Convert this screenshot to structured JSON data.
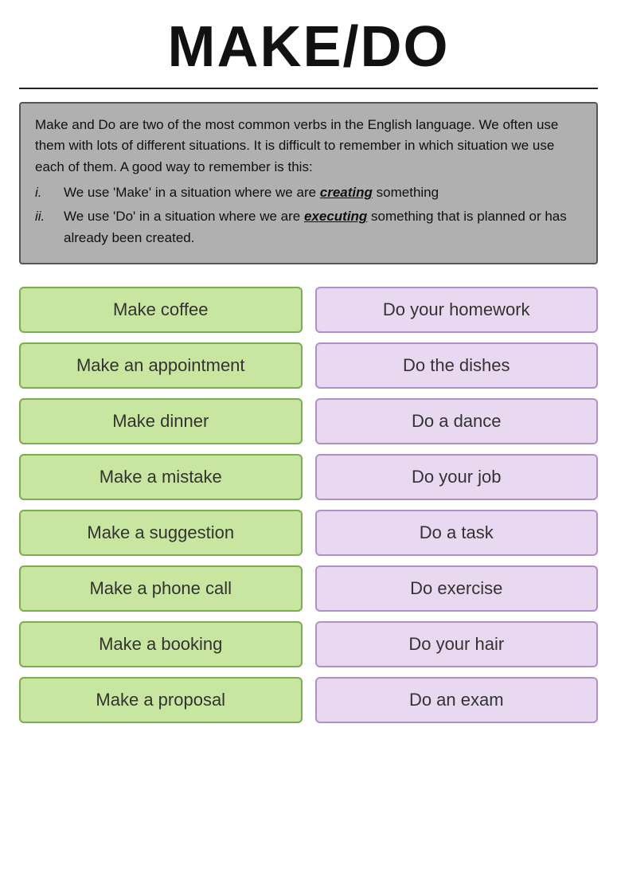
{
  "title": "MAKE/DO",
  "divider": true,
  "infoBox": {
    "intro": "Make and Do are two of the most common verbs in the English language. We often use them with lots of different situations. It is difficult to remember in which situation we use each of them. A good way to remember is this:",
    "points": [
      {
        "num": "i.",
        "text_before": "We use ‘Make’ in a situation where we are ",
        "highlight": "creating",
        "text_after": " something"
      },
      {
        "num": "ii.",
        "text_before": "We use ‘Do’ in a situation where we are ",
        "highlight": "executing",
        "text_after": " something that is planned or has already been created."
      }
    ]
  },
  "pairs": [
    {
      "make": "Make coffee",
      "do": "Do your homework"
    },
    {
      "make": "Make an appointment",
      "do": "Do the dishes"
    },
    {
      "make": "Make dinner",
      "do": "Do a dance"
    },
    {
      "make": "Make a mistake",
      "do": "Do your job"
    },
    {
      "make": "Make a suggestion",
      "do": "Do a task"
    },
    {
      "make": "Make a phone call",
      "do": "Do exercise"
    },
    {
      "make": "Make a booking",
      "do": "Do your hair"
    },
    {
      "make": "Make a proposal",
      "do": "Do an exam"
    }
  ]
}
